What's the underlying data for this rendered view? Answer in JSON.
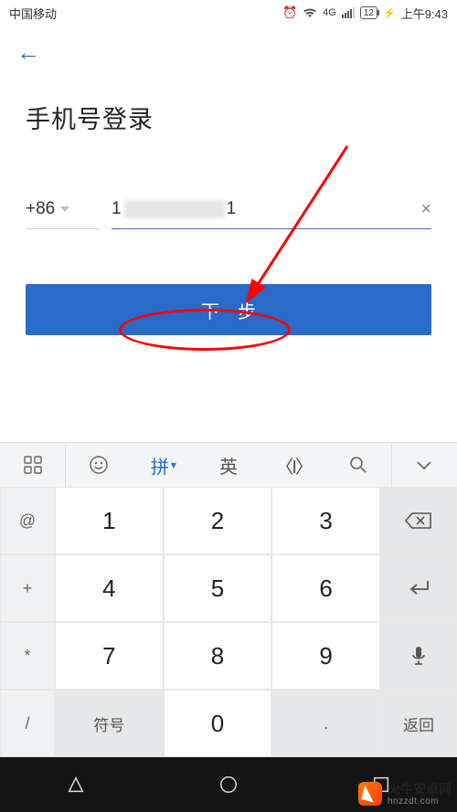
{
  "status": {
    "carrier": "中国移动",
    "network": "4G",
    "battery_text": "12",
    "time": "上午9:43"
  },
  "login": {
    "title": "手机号登录",
    "country_code": "+86",
    "phone_display_start": "1",
    "phone_display_end": "1",
    "next_button": "下一步"
  },
  "keyboard": {
    "toolbar": {
      "pinyin": "拼",
      "english": "英",
      "cursor": "〈I〉"
    },
    "side_left": [
      "@",
      "+",
      "*",
      "/"
    ],
    "digits": [
      [
        "1",
        "2",
        "3"
      ],
      [
        "4",
        "5",
        "6"
      ],
      [
        "7",
        "8",
        "9"
      ]
    ],
    "bottom": {
      "symbol": "符号",
      "zero": "0",
      "dot": ".",
      "return": "返回"
    }
  },
  "watermark": {
    "brand": "火牛安卓网",
    "url": "hnzzdt.com"
  }
}
